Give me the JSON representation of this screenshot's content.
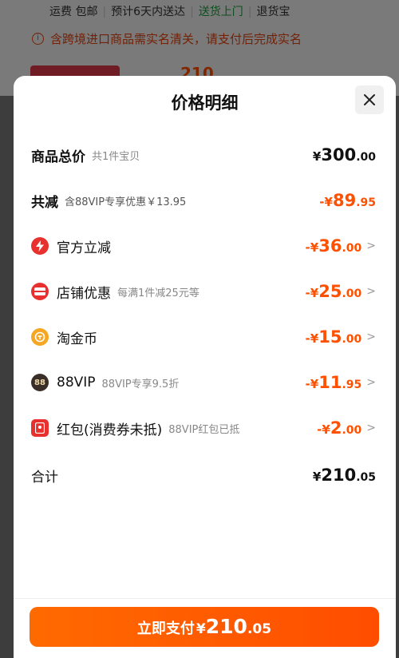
{
  "background": {
    "shipping": "运费 包邮",
    "delivery_estimate": "预计6天内送达",
    "door_delivery": "送货上门",
    "return": "退货宝",
    "notice": "含跨境进口商品需实名清关，请支付后完成实名",
    "partial_price": "210"
  },
  "sheet": {
    "title": "价格明细",
    "rows": [
      {
        "name": "商品总价",
        "sub": "共1件宝贝",
        "currency": "¥",
        "int": "300",
        "dec": ".00"
      },
      {
        "name": "共减",
        "sub": "含88VIP专享优惠￥13.95",
        "currency": "-¥",
        "int": "89",
        "dec": ".95"
      },
      {
        "name": "官方立减",
        "sub": "",
        "currency": "-¥",
        "int": "36",
        "dec": ".00",
        "icon": "lightning-icon"
      },
      {
        "name": "店铺优惠",
        "sub": "每满1件减25元等",
        "currency": "-¥",
        "int": "25",
        "dec": ".00",
        "icon": "shop-coupon-icon"
      },
      {
        "name": "淘金币",
        "sub": "",
        "currency": "-¥",
        "int": "15",
        "dec": ".00",
        "icon": "coin-icon"
      },
      {
        "name": "88VIP",
        "sub": "88VIP专享9.5折",
        "currency": "-¥",
        "int": "11",
        "dec": ".95",
        "icon": "vip-88-icon",
        "icon_text": "88"
      },
      {
        "name": "红包(消费券未抵)",
        "sub": "88VIP红包已抵",
        "currency": "-¥",
        "int": "2",
        "dec": ".00",
        "icon": "red-packet-icon"
      },
      {
        "name": "合计",
        "sub": "",
        "currency": "¥",
        "int": "210",
        "dec": ".05"
      }
    ],
    "pay": {
      "label": "立即支付",
      "currency": "¥",
      "int": "210",
      "dec": ".05"
    }
  },
  "colors": {
    "accent": "#ff5000",
    "green": "#1a9e3f",
    "red": "#e8312e",
    "coin": "#f5a623",
    "vip": "#3a2e28"
  }
}
